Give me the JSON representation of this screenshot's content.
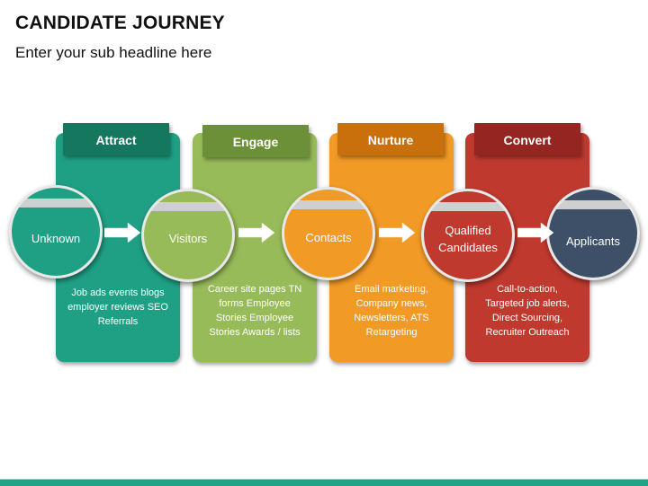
{
  "header": {
    "title": "CANDIDATE JOURNEY",
    "subtitle": "Enter your sub headline here"
  },
  "colors": {
    "attract_panel": "#1fa085",
    "attract_tab": "#16775f",
    "engage_panel": "#98bb59",
    "engage_tab": "#6c9038",
    "nurture_panel": "#f29a26",
    "nurture_tab": "#c9700c",
    "convert_panel": "#c0392f",
    "convert_tab": "#952520",
    "applicants_circle": "#3d5068",
    "bottom_bar": "#23a386"
  },
  "stages": [
    {
      "tab": "Attract",
      "description": [
        "Job ads events blogs",
        "employer reviews SEO",
        "Referrals"
      ]
    },
    {
      "tab": "Engage",
      "description": [
        "Career site pages TN",
        "forms Employee",
        "Stories Employee",
        "Stories Awards / lists"
      ]
    },
    {
      "tab": "Nurture",
      "description": [
        "Email marketing,",
        "Company news,",
        "Newsletters, ATS",
        "Retargeting"
      ]
    },
    {
      "tab": "Convert",
      "description": [
        "Call-to-action,",
        "Targeted job alerts,",
        "Direct Sourcing,",
        "Recruiter Outreach"
      ]
    }
  ],
  "nodes": [
    {
      "label": [
        "Unknown"
      ]
    },
    {
      "label": [
        "Visitors"
      ]
    },
    {
      "label": [
        "Contacts"
      ]
    },
    {
      "label": [
        "Qualified",
        "Candidates"
      ]
    },
    {
      "label": [
        "Applicants"
      ]
    }
  ],
  "arrows": [
    {
      "from": "Unknown",
      "to": "Visitors",
      "icon": "right-arrow-icon"
    },
    {
      "from": "Visitors",
      "to": "Contacts",
      "icon": "right-arrow-icon"
    },
    {
      "from": "Contacts",
      "to": "Qualified Candidates",
      "icon": "right-arrow-icon"
    },
    {
      "from": "Qualified Candidates",
      "to": "Applicants",
      "icon": "right-arrow-icon"
    }
  ]
}
